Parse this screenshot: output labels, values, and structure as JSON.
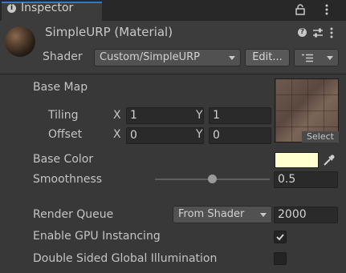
{
  "tab": {
    "label": "Inspector",
    "info_icon": "i"
  },
  "header": {
    "title": "SimpleURP (Material)",
    "shader_label": "Shader",
    "shader_value": "Custom/SimpleURP",
    "edit_label": "Edit...",
    "help_icon": "?"
  },
  "properties": {
    "base_map_label": "Base Map",
    "tiling_label": "Tiling",
    "offset_label": "Offset",
    "tiling": {
      "x": "1",
      "y": "1"
    },
    "offset": {
      "x": "0",
      "y": "0"
    },
    "axis_x": "X",
    "axis_y": "Y",
    "texture_select_label": "Select",
    "base_color_label": "Base Color",
    "base_color": "#ffffd0",
    "smoothness_label": "Smoothness",
    "smoothness_value": "0.5",
    "smoothness_fraction": 0.5,
    "render_queue_label": "Render Queue",
    "render_queue_mode": "From Shader",
    "render_queue_value": "2000",
    "gpu_instancing_label": "Enable GPU Instancing",
    "gpu_instancing_checked": true,
    "double_sided_gi_label": "Double Sided Global Illumination",
    "double_sided_gi_checked": false
  },
  "colors": {
    "accent": "#3a79bb",
    "background": "#383838"
  }
}
